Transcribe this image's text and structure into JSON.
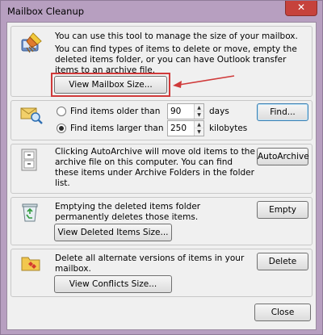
{
  "window": {
    "title": "Mailbox Cleanup",
    "close_glyph": "✕"
  },
  "mailbox": {
    "intro": "You can use this tool to manage the size of your mailbox.",
    "detail": "You can find types of items to delete or move, empty the deleted items folder, or you can have Outlook transfer items to an archive file.",
    "view_size_label": "View Mailbox Size..."
  },
  "find": {
    "older_label": "Find items older than",
    "older_value": "90",
    "older_unit": "days",
    "larger_label": "Find items larger than",
    "larger_value": "250",
    "larger_unit": "kilobytes",
    "selected": "larger",
    "find_label": "Find..."
  },
  "autoarchive": {
    "text": "Clicking AutoArchive will move old items to the archive file on this computer. You can find these items under Archive Folders in the folder list.",
    "button_label": "AutoArchive"
  },
  "deleted": {
    "text": "Emptying the deleted items folder permanently deletes those items.",
    "empty_label": "Empty",
    "view_label": "View Deleted Items Size..."
  },
  "conflicts": {
    "text": "Delete all alternate versions of items in your mailbox.",
    "delete_label": "Delete",
    "view_label": "View Conflicts Size..."
  },
  "footer": {
    "close_label": "Close"
  },
  "annotation": {
    "highlight_color": "#d03a3a"
  }
}
